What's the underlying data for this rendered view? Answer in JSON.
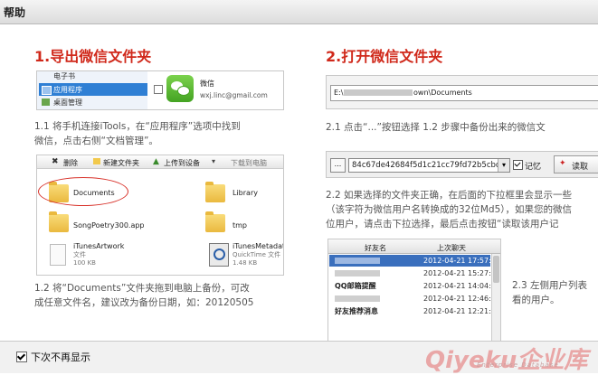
{
  "window": {
    "title": "帮助"
  },
  "sections": {
    "s1": {
      "heading": "1.导出微信文件夹",
      "text_1_1_a": "1.1 将手机连接iTools，在“应用程序”选项中找到",
      "text_1_1_b": "微信，点击右侧“文档管理”。",
      "text_1_2_a": "1.2 将“Documents”文件夹拖到电脑上备份，可改",
      "text_1_2_b": "成任意文件名，建议改为备份日期，如：20120505"
    },
    "s2": {
      "heading": "2.打开微信文件夹",
      "text_2_1": "2.1 点击“...”按钮选择 1.2 步骤中备份出来的微信文",
      "text_2_2_a": "2.2 如果选择的文件夹正确，在后面的下拉框里会显示一些",
      "text_2_2_b": "（该字符为微信用户名转换成的32位Md5），如果您的微信",
      "text_2_2_c": "位用户，请点击下拉选择，最后点击按钮“读取该用户记",
      "text_2_3_a": "2.3 左侧用户列表",
      "text_2_3_b": "看的用户。"
    }
  },
  "shot_itools": {
    "nav": [
      "电子书",
      "应用程序",
      "桌面管理"
    ],
    "app_name": "微信",
    "app_account": "wxj.linc@gmail.com"
  },
  "shot_files": {
    "toolbar": {
      "delete": "删除",
      "new_folder": "新建文件夹",
      "upload": "上传到设备",
      "download": "下载到电脑"
    },
    "items": [
      {
        "name": "Documents"
      },
      {
        "name": "Library"
      },
      {
        "name": "SongPoetry300.app"
      },
      {
        "name": "tmp"
      },
      {
        "name": "iTunesArtwork",
        "type": "文件",
        "size": "100 KB"
      },
      {
        "name": "iTunesMetadat",
        "type": "QuickTime 文件",
        "size": "1.48 KB"
      }
    ]
  },
  "shot_path": {
    "prefix": "E:\\",
    "suffix": "own\\Documents"
  },
  "shot_select": {
    "browse": "...",
    "user_hash": "84c67de42684f5d1c21cc79fd72b5cbc",
    "remember": "记忆",
    "read": "读取"
  },
  "shot_friends": {
    "col_name": "好友名",
    "col_time": "上次聊天",
    "rows": [
      {
        "name": "",
        "time": "2012-04-21 17:57:20"
      },
      {
        "name": "",
        "time": "2012-04-21 15:27:34"
      },
      {
        "name": "QQ邮箱提醒",
        "time": "2012-04-21 14:04:07"
      },
      {
        "name": "",
        "time": "2012-04-21 12:46:57"
      },
      {
        "name": "好友推荐消息",
        "time": "2012-04-21 12:21:22"
      }
    ]
  },
  "footer": {
    "dont_show_again": "下次不再显示"
  },
  "watermark": {
    "brand": "Qiyeku企业库",
    "sub": "Enterprise Database"
  }
}
